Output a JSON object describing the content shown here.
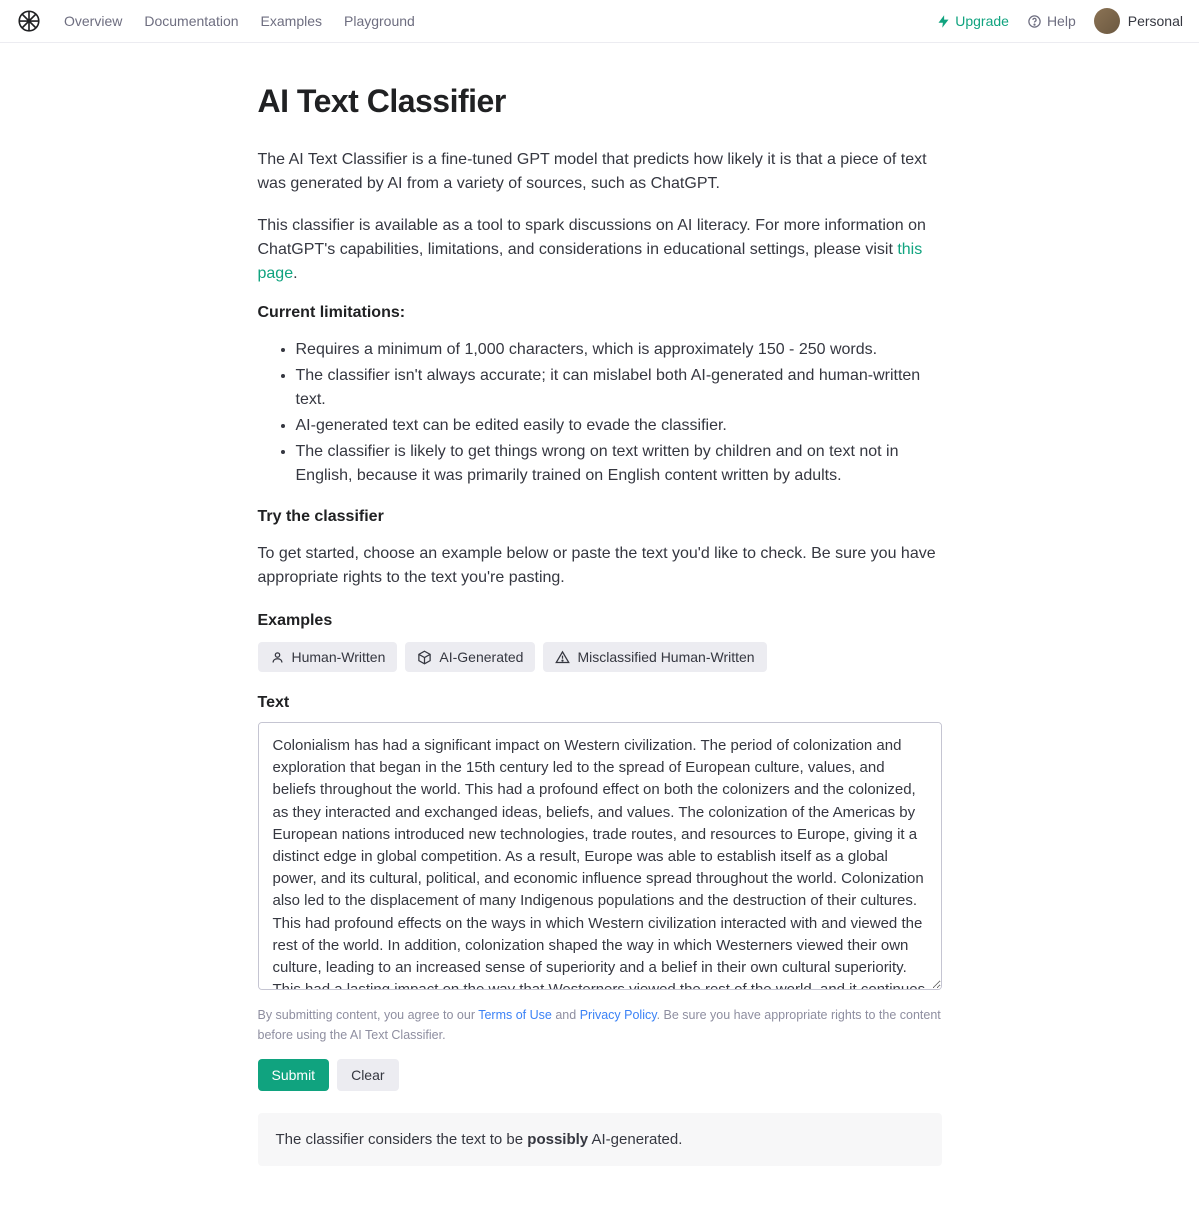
{
  "header": {
    "nav": {
      "overview": "Overview",
      "documentation": "Documentation",
      "examples": "Examples",
      "playground": "Playground"
    },
    "upgrade": "Upgrade",
    "help": "Help",
    "account": "Personal"
  },
  "page": {
    "title": "AI Text Classifier",
    "intro1": "The AI Text Classifier is a fine-tuned GPT model that predicts how likely it is that a piece of text was generated by AI from a variety of sources, such as ChatGPT.",
    "intro2_pre": "This classifier is available as a tool to spark discussions on AI literacy. For more information on ChatGPT's capabilities, limitations, and considerations in educational settings, please visit ",
    "intro2_link": "this page",
    "intro2_post": ".",
    "limitations_label": "Current limitations:",
    "limitations": [
      "Requires a minimum of 1,000 characters, which is approximately 150 - 250 words.",
      "The classifier isn't always accurate; it can mislabel both AI-generated and human-written text.",
      "AI-generated text can be edited easily to evade the classifier.",
      "The classifier is likely to get things wrong on text written by children and on text not in English, because it was primarily trained on English content written by adults."
    ],
    "try_label": "Try the classifier",
    "try_text": "To get started, choose an example below or paste the text you'd like to check. Be sure you have appropriate rights to the text you're pasting.",
    "examples_heading": "Examples",
    "chips": {
      "human": "Human-Written",
      "ai": "AI-Generated",
      "misclassified": "Misclassified Human-Written"
    },
    "text_heading": "Text",
    "textarea_value": "Colonialism has had a significant impact on Western civilization. The period of colonization and exploration that began in the 15th century led to the spread of European culture, values, and beliefs throughout the world. This had a profound effect on both the colonizers and the colonized, as they interacted and exchanged ideas, beliefs, and values. The colonization of the Americas by European nations introduced new technologies, trade routes, and resources to Europe, giving it a distinct edge in global competition. As a result, Europe was able to establish itself as a global power, and its cultural, political, and economic influence spread throughout the world. Colonization also led to the displacement of many Indigenous populations and the destruction of their cultures. This had profound effects on the ways in which Western civilization interacted with and viewed the rest of the world. In addition, colonization shaped the way in which Westerners viewed their own culture, leading to an increased sense of superiority and a belief in their own cultural superiority. This had a lasting impact on the way that Westerners viewed the rest of the world, and it continues to shape the way in which Westerners interact with other cultures today.",
    "disclaimer_pre": "By submitting content, you agree to our ",
    "disclaimer_terms": "Terms of Use",
    "disclaimer_and": " and ",
    "disclaimer_privacy": "Privacy Policy",
    "disclaimer_post": ". Be sure you have appropriate rights to the content before using the AI Text Classifier.",
    "submit": "Submit",
    "clear": "Clear",
    "result_pre": "The classifier considers the text to be ",
    "result_verdict": "possibly",
    "result_post": " AI-generated."
  }
}
